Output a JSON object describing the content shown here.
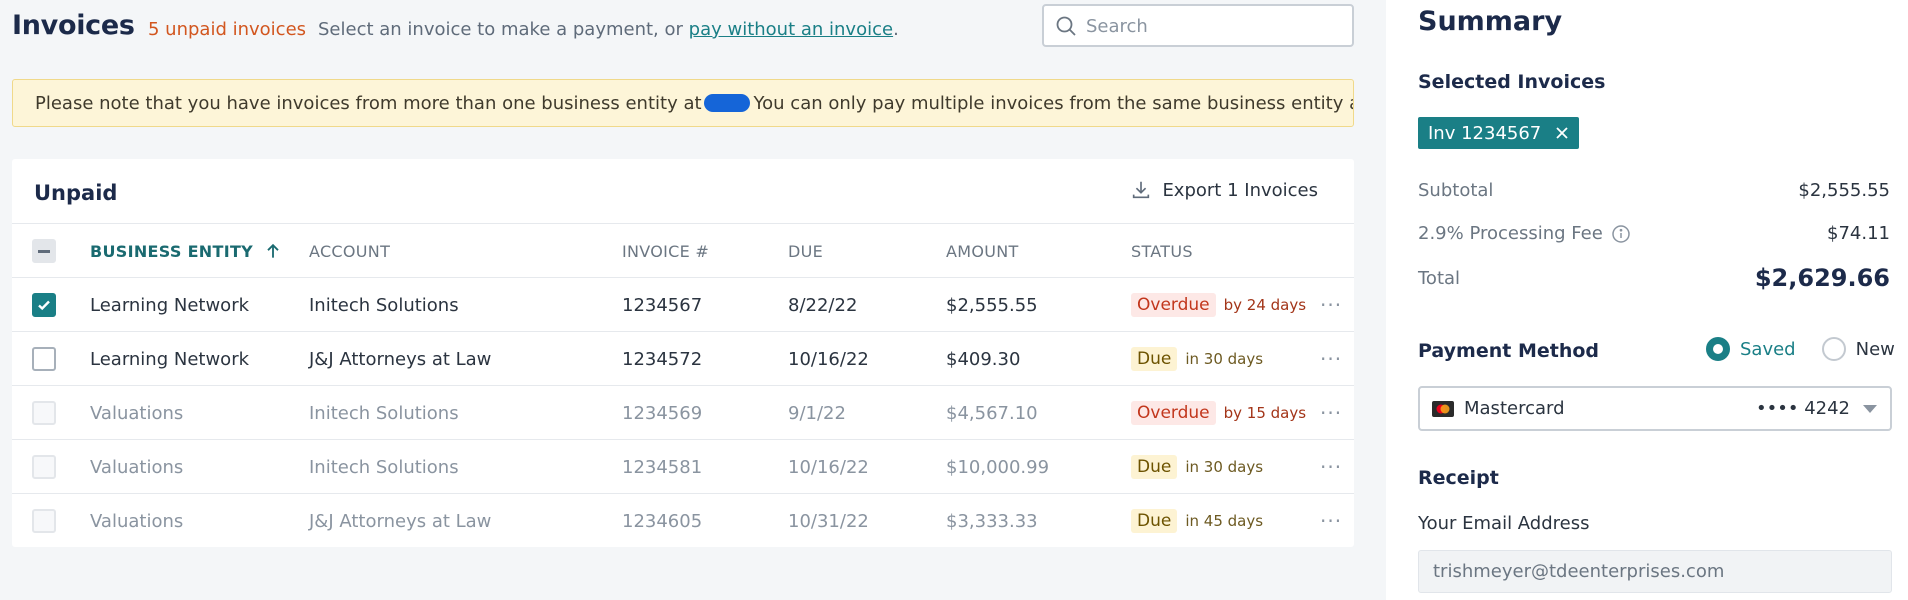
{
  "header": {
    "title": "Invoices",
    "unpaid_count": "5 unpaid invoices",
    "intro_text": "Select an invoice to make a payment, or",
    "intro_link": "pay without an invoice",
    "intro_end": ".",
    "search_placeholder": "Search"
  },
  "notice": {
    "text_before": "Please note that you have invoices from more than one business entity at",
    "text_after": "You can only pay multiple invoices from the same business entity at a time."
  },
  "table": {
    "title": "Unpaid",
    "export_label": "Export 1 Invoices",
    "columns": {
      "entity": "BUSINESS ENTITY",
      "account": "ACCOUNT",
      "invoice": "INVOICE #",
      "due": "DUE",
      "amount": "AMOUNT",
      "status": "STATUS"
    },
    "rows": [
      {
        "entity": "Learning Network",
        "account": "Initech Solutions",
        "invoice": "1234567",
        "due": "8/22/22",
        "amount": "$2,555.55",
        "status": "Overdue",
        "status_detail": "by 24 days",
        "checked": true,
        "disabled": false
      },
      {
        "entity": "Learning Network",
        "account": "J&J Attorneys at Law",
        "invoice": "1234572",
        "due": "10/16/22",
        "amount": "$409.30",
        "status": "Due",
        "status_detail": "in 30 days",
        "checked": false,
        "disabled": false
      },
      {
        "entity": "Valuations",
        "account": "Initech Solutions",
        "invoice": "1234569",
        "due": "9/1/22",
        "amount": "$4,567.10",
        "status": "Overdue",
        "status_detail": "by 15 days",
        "checked": false,
        "disabled": true
      },
      {
        "entity": "Valuations",
        "account": "Initech Solutions",
        "invoice": "1234581",
        "due": "10/16/22",
        "amount": "$10,000.99",
        "status": "Due",
        "status_detail": "in 30 days",
        "checked": false,
        "disabled": true
      },
      {
        "entity": "Valuations",
        "account": "J&J Attorneys at Law",
        "invoice": "1234605",
        "due": "10/31/22",
        "amount": "$3,333.33",
        "status": "Due",
        "status_detail": "in 45 days",
        "checked": false,
        "disabled": true
      }
    ],
    "more_glyph": "···"
  },
  "summary": {
    "title": "Summary",
    "selected_label": "Selected Invoices",
    "chip_label": "Inv 1234567",
    "subtotal_label": "Subtotal",
    "subtotal_value": "$2,555.55",
    "fee_label": "2.9% Processing Fee",
    "fee_value": "$74.11",
    "total_label": "Total",
    "total_value": "$2,629.66",
    "payment_label": "Payment Method",
    "radio_saved": "Saved",
    "radio_new": "New",
    "card_name": "Mastercard",
    "card_last4": "•••• 4242",
    "receipt_label": "Receipt",
    "email_label": "Your Email Address",
    "email_value": "trishmeyer@tdeenterprises.com"
  },
  "colors": {
    "accent": "#1a7f86",
    "overdue": "#c2361c",
    "unpaid_count": "#d2561f",
    "notice_bg": "#fdf5d8"
  }
}
